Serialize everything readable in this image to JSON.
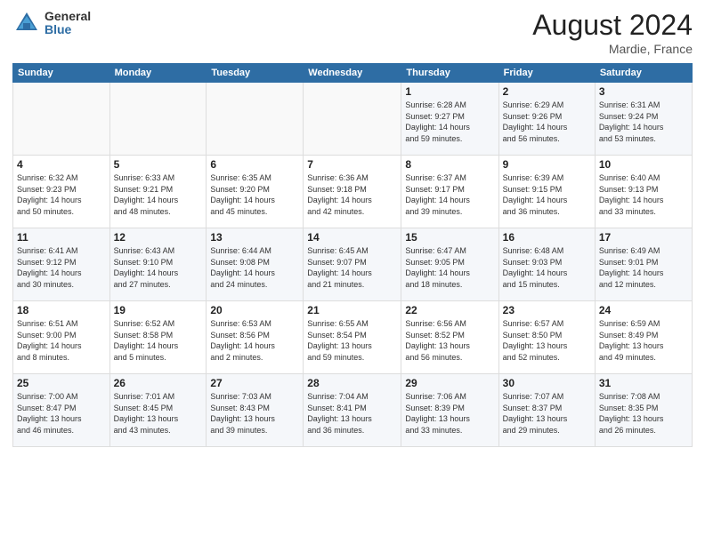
{
  "header": {
    "logo_general": "General",
    "logo_blue": "Blue",
    "month_title": "August 2024",
    "location": "Mardie, France"
  },
  "calendar": {
    "days_of_week": [
      "Sunday",
      "Monday",
      "Tuesday",
      "Wednesday",
      "Thursday",
      "Friday",
      "Saturday"
    ],
    "weeks": [
      [
        {
          "day": "",
          "info": ""
        },
        {
          "day": "",
          "info": ""
        },
        {
          "day": "",
          "info": ""
        },
        {
          "day": "",
          "info": ""
        },
        {
          "day": "1",
          "info": "Sunrise: 6:28 AM\nSunset: 9:27 PM\nDaylight: 14 hours\nand 59 minutes."
        },
        {
          "day": "2",
          "info": "Sunrise: 6:29 AM\nSunset: 9:26 PM\nDaylight: 14 hours\nand 56 minutes."
        },
        {
          "day": "3",
          "info": "Sunrise: 6:31 AM\nSunset: 9:24 PM\nDaylight: 14 hours\nand 53 minutes."
        }
      ],
      [
        {
          "day": "4",
          "info": "Sunrise: 6:32 AM\nSunset: 9:23 PM\nDaylight: 14 hours\nand 50 minutes."
        },
        {
          "day": "5",
          "info": "Sunrise: 6:33 AM\nSunset: 9:21 PM\nDaylight: 14 hours\nand 48 minutes."
        },
        {
          "day": "6",
          "info": "Sunrise: 6:35 AM\nSunset: 9:20 PM\nDaylight: 14 hours\nand 45 minutes."
        },
        {
          "day": "7",
          "info": "Sunrise: 6:36 AM\nSunset: 9:18 PM\nDaylight: 14 hours\nand 42 minutes."
        },
        {
          "day": "8",
          "info": "Sunrise: 6:37 AM\nSunset: 9:17 PM\nDaylight: 14 hours\nand 39 minutes."
        },
        {
          "day": "9",
          "info": "Sunrise: 6:39 AM\nSunset: 9:15 PM\nDaylight: 14 hours\nand 36 minutes."
        },
        {
          "day": "10",
          "info": "Sunrise: 6:40 AM\nSunset: 9:13 PM\nDaylight: 14 hours\nand 33 minutes."
        }
      ],
      [
        {
          "day": "11",
          "info": "Sunrise: 6:41 AM\nSunset: 9:12 PM\nDaylight: 14 hours\nand 30 minutes."
        },
        {
          "day": "12",
          "info": "Sunrise: 6:43 AM\nSunset: 9:10 PM\nDaylight: 14 hours\nand 27 minutes."
        },
        {
          "day": "13",
          "info": "Sunrise: 6:44 AM\nSunset: 9:08 PM\nDaylight: 14 hours\nand 24 minutes."
        },
        {
          "day": "14",
          "info": "Sunrise: 6:45 AM\nSunset: 9:07 PM\nDaylight: 14 hours\nand 21 minutes."
        },
        {
          "day": "15",
          "info": "Sunrise: 6:47 AM\nSunset: 9:05 PM\nDaylight: 14 hours\nand 18 minutes."
        },
        {
          "day": "16",
          "info": "Sunrise: 6:48 AM\nSunset: 9:03 PM\nDaylight: 14 hours\nand 15 minutes."
        },
        {
          "day": "17",
          "info": "Sunrise: 6:49 AM\nSunset: 9:01 PM\nDaylight: 14 hours\nand 12 minutes."
        }
      ],
      [
        {
          "day": "18",
          "info": "Sunrise: 6:51 AM\nSunset: 9:00 PM\nDaylight: 14 hours\nand 8 minutes."
        },
        {
          "day": "19",
          "info": "Sunrise: 6:52 AM\nSunset: 8:58 PM\nDaylight: 14 hours\nand 5 minutes."
        },
        {
          "day": "20",
          "info": "Sunrise: 6:53 AM\nSunset: 8:56 PM\nDaylight: 14 hours\nand 2 minutes."
        },
        {
          "day": "21",
          "info": "Sunrise: 6:55 AM\nSunset: 8:54 PM\nDaylight: 13 hours\nand 59 minutes."
        },
        {
          "day": "22",
          "info": "Sunrise: 6:56 AM\nSunset: 8:52 PM\nDaylight: 13 hours\nand 56 minutes."
        },
        {
          "day": "23",
          "info": "Sunrise: 6:57 AM\nSunset: 8:50 PM\nDaylight: 13 hours\nand 52 minutes."
        },
        {
          "day": "24",
          "info": "Sunrise: 6:59 AM\nSunset: 8:49 PM\nDaylight: 13 hours\nand 49 minutes."
        }
      ],
      [
        {
          "day": "25",
          "info": "Sunrise: 7:00 AM\nSunset: 8:47 PM\nDaylight: 13 hours\nand 46 minutes."
        },
        {
          "day": "26",
          "info": "Sunrise: 7:01 AM\nSunset: 8:45 PM\nDaylight: 13 hours\nand 43 minutes."
        },
        {
          "day": "27",
          "info": "Sunrise: 7:03 AM\nSunset: 8:43 PM\nDaylight: 13 hours\nand 39 minutes."
        },
        {
          "day": "28",
          "info": "Sunrise: 7:04 AM\nSunset: 8:41 PM\nDaylight: 13 hours\nand 36 minutes."
        },
        {
          "day": "29",
          "info": "Sunrise: 7:06 AM\nSunset: 8:39 PM\nDaylight: 13 hours\nand 33 minutes."
        },
        {
          "day": "30",
          "info": "Sunrise: 7:07 AM\nSunset: 8:37 PM\nDaylight: 13 hours\nand 29 minutes."
        },
        {
          "day": "31",
          "info": "Sunrise: 7:08 AM\nSunset: 8:35 PM\nDaylight: 13 hours\nand 26 minutes."
        }
      ]
    ]
  }
}
